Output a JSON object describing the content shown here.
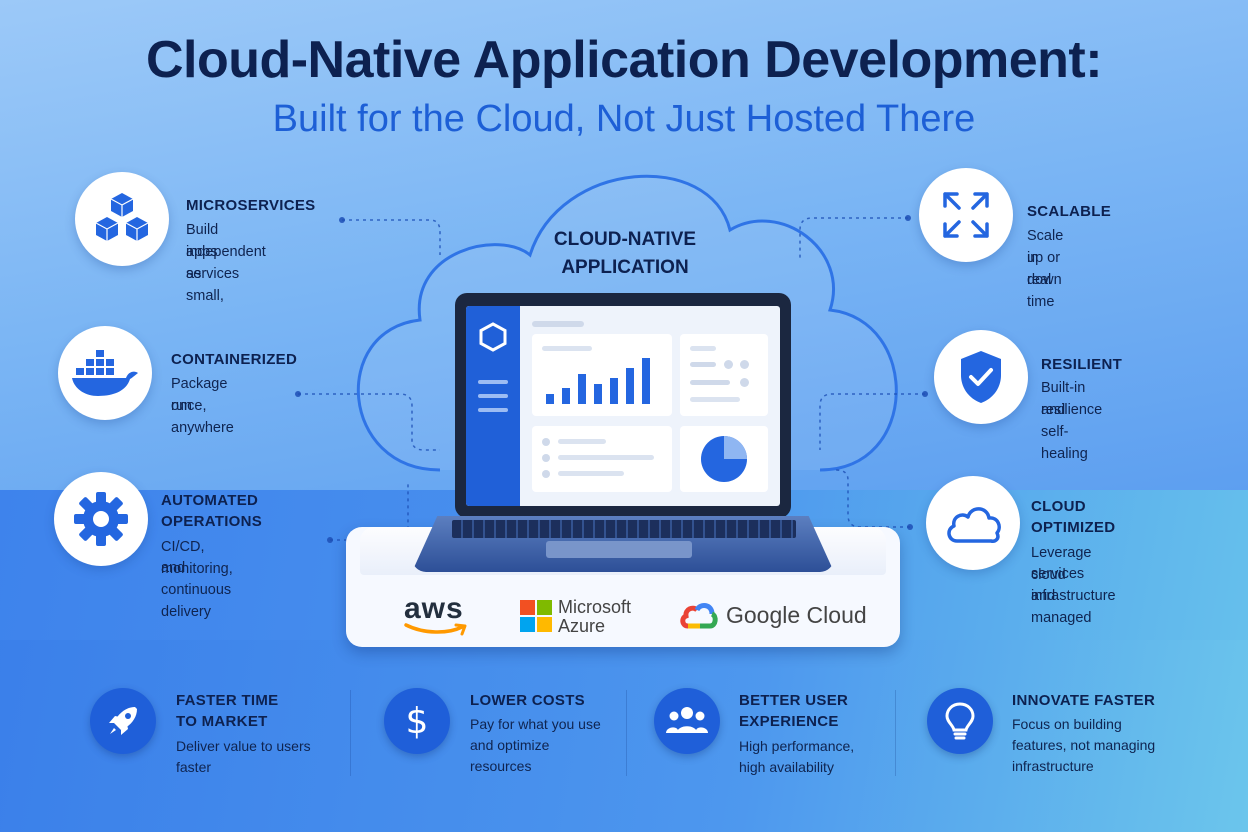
{
  "title": "Cloud-Native Application Development:",
  "subtitle": "Built for the Cloud, Not Just Hosted There",
  "center": {
    "label_line1": "CLOUD-NATIVE",
    "label_line2": "APPLICATION"
  },
  "left_features": [
    {
      "title": "MICROSERVICES",
      "desc1": "Build apps as small,",
      "desc2": "independent services",
      "icon": "cubes-icon"
    },
    {
      "title": "CONTAINERIZED",
      "desc1": "Package once,",
      "desc2": "run anywhere",
      "icon": "docker-whale-icon"
    },
    {
      "title1": "AUTOMATED",
      "title2": "OPERATIONS",
      "desc1": "CI/CD, monitoring,",
      "desc2": "and continuous delivery",
      "icon": "gear-icon"
    }
  ],
  "right_features": [
    {
      "title": "SCALABLE",
      "desc1": "Scale up or down",
      "desc2": "in real time",
      "icon": "expand-arrows-icon"
    },
    {
      "title": "RESILIENT",
      "desc1": "Built-in resilience",
      "desc2": "and self-healing",
      "icon": "shield-check-icon"
    },
    {
      "title1": "CLOUD",
      "title2": "OPTIMIZED",
      "desc1": "Leverage cloud",
      "desc2": "services and managed",
      "desc3": "infrastructure",
      "icon": "cloud-icon"
    }
  ],
  "providers": {
    "aws": "aws",
    "azure_line1": "Microsoft",
    "azure_line2": "Azure",
    "google": "Google Cloud"
  },
  "bottom": [
    {
      "title1": "FASTER TIME",
      "title2": "TO MARKET",
      "desc1": "Deliver value to users",
      "desc2": "faster",
      "icon": "rocket-icon"
    },
    {
      "title1": "LOWER COSTS",
      "desc1": "Pay for what you use",
      "desc2": "and optimize",
      "desc3": "resources",
      "icon": "dollar-icon"
    },
    {
      "title1": "BETTER USER",
      "title2": "EXPERIENCE",
      "desc1": "High performance,",
      "desc2": "high availability",
      "icon": "users-icon"
    },
    {
      "title1": "INNOVATE FASTER",
      "desc1": "Focus on building",
      "desc2": "features, not managing",
      "desc3": "infrastructure",
      "icon": "lightbulb-icon"
    }
  ],
  "colors": {
    "navy": "#0d2150",
    "accent": "#1d5fd6",
    "icon_blue": "#2466e0"
  }
}
